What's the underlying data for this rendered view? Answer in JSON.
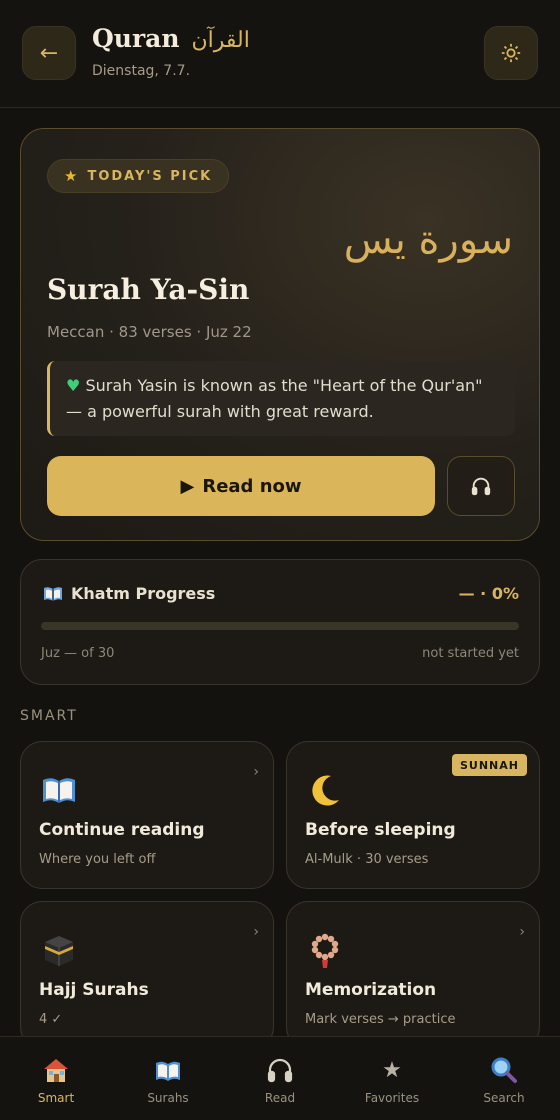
{
  "header": {
    "back_icon": "arrow-left-icon",
    "title": "Quran",
    "title_arabic": "القرآن",
    "date": "Dienstag, 7.7.",
    "settings_icon": "sun-gear-icon"
  },
  "hero": {
    "badge": "TODAY'S PICK",
    "arabic_name": "سورة يس",
    "name": "Surah Ya-Sin",
    "meta": "Meccan · 83 verses · Juz 22",
    "quote": "Surah Yasin is known as the \"Heart of the Qur'an\" — a powerful surah with great reward.",
    "read_label": "Read now",
    "listen_icon": "headphones-icon"
  },
  "khatm": {
    "title": "Khatm Progress",
    "percent_label": "— · 0%",
    "progress": 0,
    "juz_label": "Juz — of 30",
    "status": "not started yet"
  },
  "smart": {
    "label": "SMART",
    "cards": [
      {
        "icon": "open-book-icon",
        "title": "Continue reading",
        "subtitle": "Where you left off",
        "badge": ""
      },
      {
        "icon": "crescent-moon-icon",
        "title": "Before sleeping",
        "subtitle": "Al-Mulk · 30 verses",
        "badge": "SUNNAH"
      },
      {
        "icon": "kaaba-icon",
        "title": "Hajj Surahs",
        "subtitle": "4 ✓",
        "badge": ""
      },
      {
        "icon": "prayer-beads-icon",
        "title": "Memorization",
        "subtitle": "Mark verses → practice",
        "badge": ""
      }
    ]
  },
  "nav": {
    "items": [
      {
        "label": "Smart",
        "icon": "house-icon",
        "active": true
      },
      {
        "label": "Surahs",
        "icon": "book-icon",
        "active": false
      },
      {
        "label": "Read",
        "icon": "headphones-icon",
        "active": false
      },
      {
        "label": "Favorites",
        "icon": "star-icon",
        "active": false
      },
      {
        "label": "Search",
        "icon": "magnifier-icon",
        "active": false
      }
    ]
  },
  "colors": {
    "accent": "#d8b560",
    "background": "#14120e",
    "card": "#1d1a15"
  }
}
